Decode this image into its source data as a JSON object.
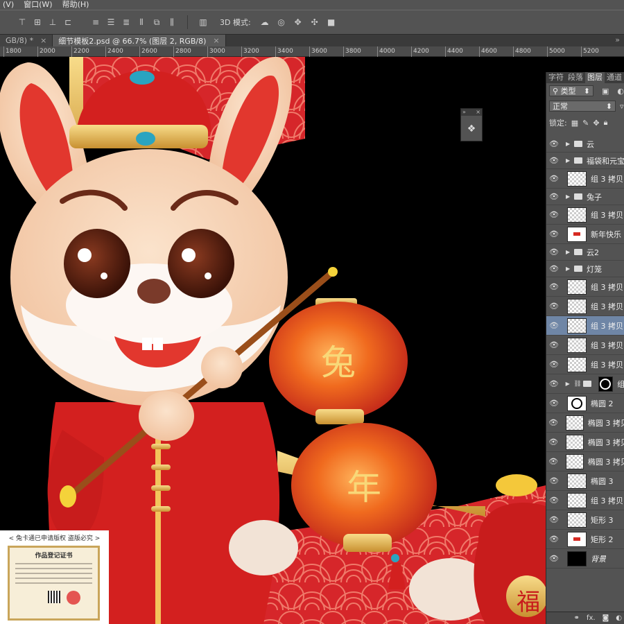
{
  "menu": {
    "items": [
      "(V)",
      "窗口(W)",
      "帮助(H)"
    ]
  },
  "options_bar": {
    "mode_label": "3D 模式:"
  },
  "tabs": [
    {
      "label": "GB/8) *",
      "active": false
    },
    {
      "label": "细节模板2.psd @ 66.7% (图层 2, RGB/8)",
      "active": true
    }
  ],
  "ruler": {
    "ticks": [
      "1800",
      "2000",
      "2200",
      "2400",
      "2600",
      "2800",
      "3000",
      "3200",
      "3400",
      "3600",
      "3800",
      "4000",
      "4200",
      "4400",
      "4600",
      "4800",
      "5000",
      "5200"
    ]
  },
  "canvas": {
    "lantern_chars": [
      "兔",
      "年"
    ],
    "bag_char": "福"
  },
  "layers_panel": {
    "tabs": [
      "字符",
      "段落",
      "图层",
      "通道"
    ],
    "active_tab": "图层",
    "filter_label": "类型",
    "blend_mode": "正常",
    "lock_label": "锁定:",
    "layers": [
      {
        "name": "云",
        "kind": "folder",
        "selected": false
      },
      {
        "name": "福袋和元宝",
        "kind": "folder",
        "selected": false
      },
      {
        "name": "组 3 拷贝",
        "kind": "layer",
        "thumb": "checker",
        "selected": false
      },
      {
        "name": "兔子",
        "kind": "folder",
        "selected": false
      },
      {
        "name": "组 3 拷贝",
        "kind": "layer",
        "thumb": "checker",
        "selected": false
      },
      {
        "name": "新年快乐",
        "kind": "layer",
        "thumb": "red",
        "selected": false
      },
      {
        "name": "云2",
        "kind": "folder",
        "selected": false
      },
      {
        "name": "灯笼",
        "kind": "folder",
        "selected": false
      },
      {
        "name": "组 3 拷贝",
        "kind": "layer",
        "thumb": "checker",
        "selected": false
      },
      {
        "name": "组 3 拷贝",
        "kind": "layer",
        "thumb": "checker",
        "selected": false
      },
      {
        "name": "组 3 拷贝",
        "kind": "layer",
        "thumb": "checker",
        "selected": true
      },
      {
        "name": "组 3 拷贝",
        "kind": "layer",
        "thumb": "checker",
        "selected": false
      },
      {
        "name": "组 3 拷贝",
        "kind": "layer",
        "thumb": "checker",
        "selected": false
      },
      {
        "name": "组",
        "kind": "masked-folder",
        "selected": false
      },
      {
        "name": "椭圆 2",
        "kind": "layer",
        "thumb": "ring",
        "selected": false
      },
      {
        "name": "椭圆 3 拷贝",
        "kind": "layer",
        "thumb": "checker",
        "selected": false
      },
      {
        "name": "椭圆 3 拷贝",
        "kind": "layer",
        "thumb": "checker",
        "selected": false
      },
      {
        "name": "椭圆 3 拷贝",
        "kind": "layer",
        "thumb": "checker",
        "selected": false
      },
      {
        "name": "椭圆 3",
        "kind": "layer",
        "thumb": "checker",
        "selected": false
      },
      {
        "name": "组 3 拷贝",
        "kind": "layer",
        "thumb": "checker",
        "selected": false
      },
      {
        "name": "矩形 3",
        "kind": "layer",
        "thumb": "checker",
        "selected": false
      },
      {
        "name": "矩形 2",
        "kind": "layer",
        "thumb": "red",
        "selected": false
      },
      {
        "name": "背景",
        "kind": "background",
        "thumb": "black",
        "selected": false
      }
    ],
    "footer_icons": [
      "link-icon",
      "fx-icon",
      "mask-icon",
      "adjustment-icon"
    ],
    "footer_fx": "fx."
  },
  "certificate": {
    "caption": "< 兔卡通已申请版权 盗版必究 >",
    "title": "作品登记证书"
  },
  "colors": {
    "panel_bg": "#535353",
    "selected_layer": "#6f86a6",
    "red": "#d62a22",
    "gold": "#e6b64a"
  }
}
